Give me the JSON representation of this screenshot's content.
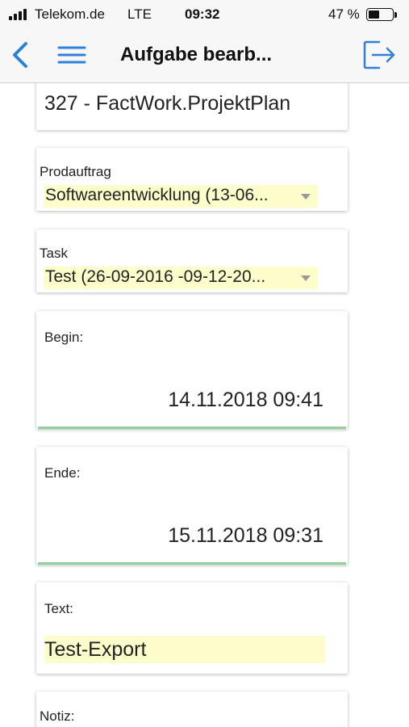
{
  "status": {
    "carrier": "Telekom.de",
    "network": "LTE",
    "time": "09:32",
    "battery": "47 %",
    "battery_level": 0.47
  },
  "nav": {
    "title": "Aufgabe bearb...",
    "back_icon": "chevron-left-icon",
    "menu_icon": "hamburger-menu-icon",
    "logout_icon": "logout-icon",
    "accent_color": "#2f80d6"
  },
  "form": {
    "project": "327 - FactWork.ProjektPlan",
    "prodauftrag": {
      "label": "Prodauftrag",
      "value": "Softwareentwicklung (13-06..."
    },
    "task": {
      "label": "Task",
      "value": "Test (26-09-2016 -09-12-20..."
    },
    "begin": {
      "label": "Begin:",
      "value": "14.11.2018 09:41"
    },
    "ende": {
      "label": "Ende:",
      "value": "15.11.2018 09:31"
    },
    "text": {
      "label": "Text:",
      "value": "Test-Export"
    },
    "notiz": {
      "label": "Notiz:"
    }
  },
  "colors": {
    "input_highlight": "#fdfccb",
    "focus_line": "#8ed29a"
  }
}
